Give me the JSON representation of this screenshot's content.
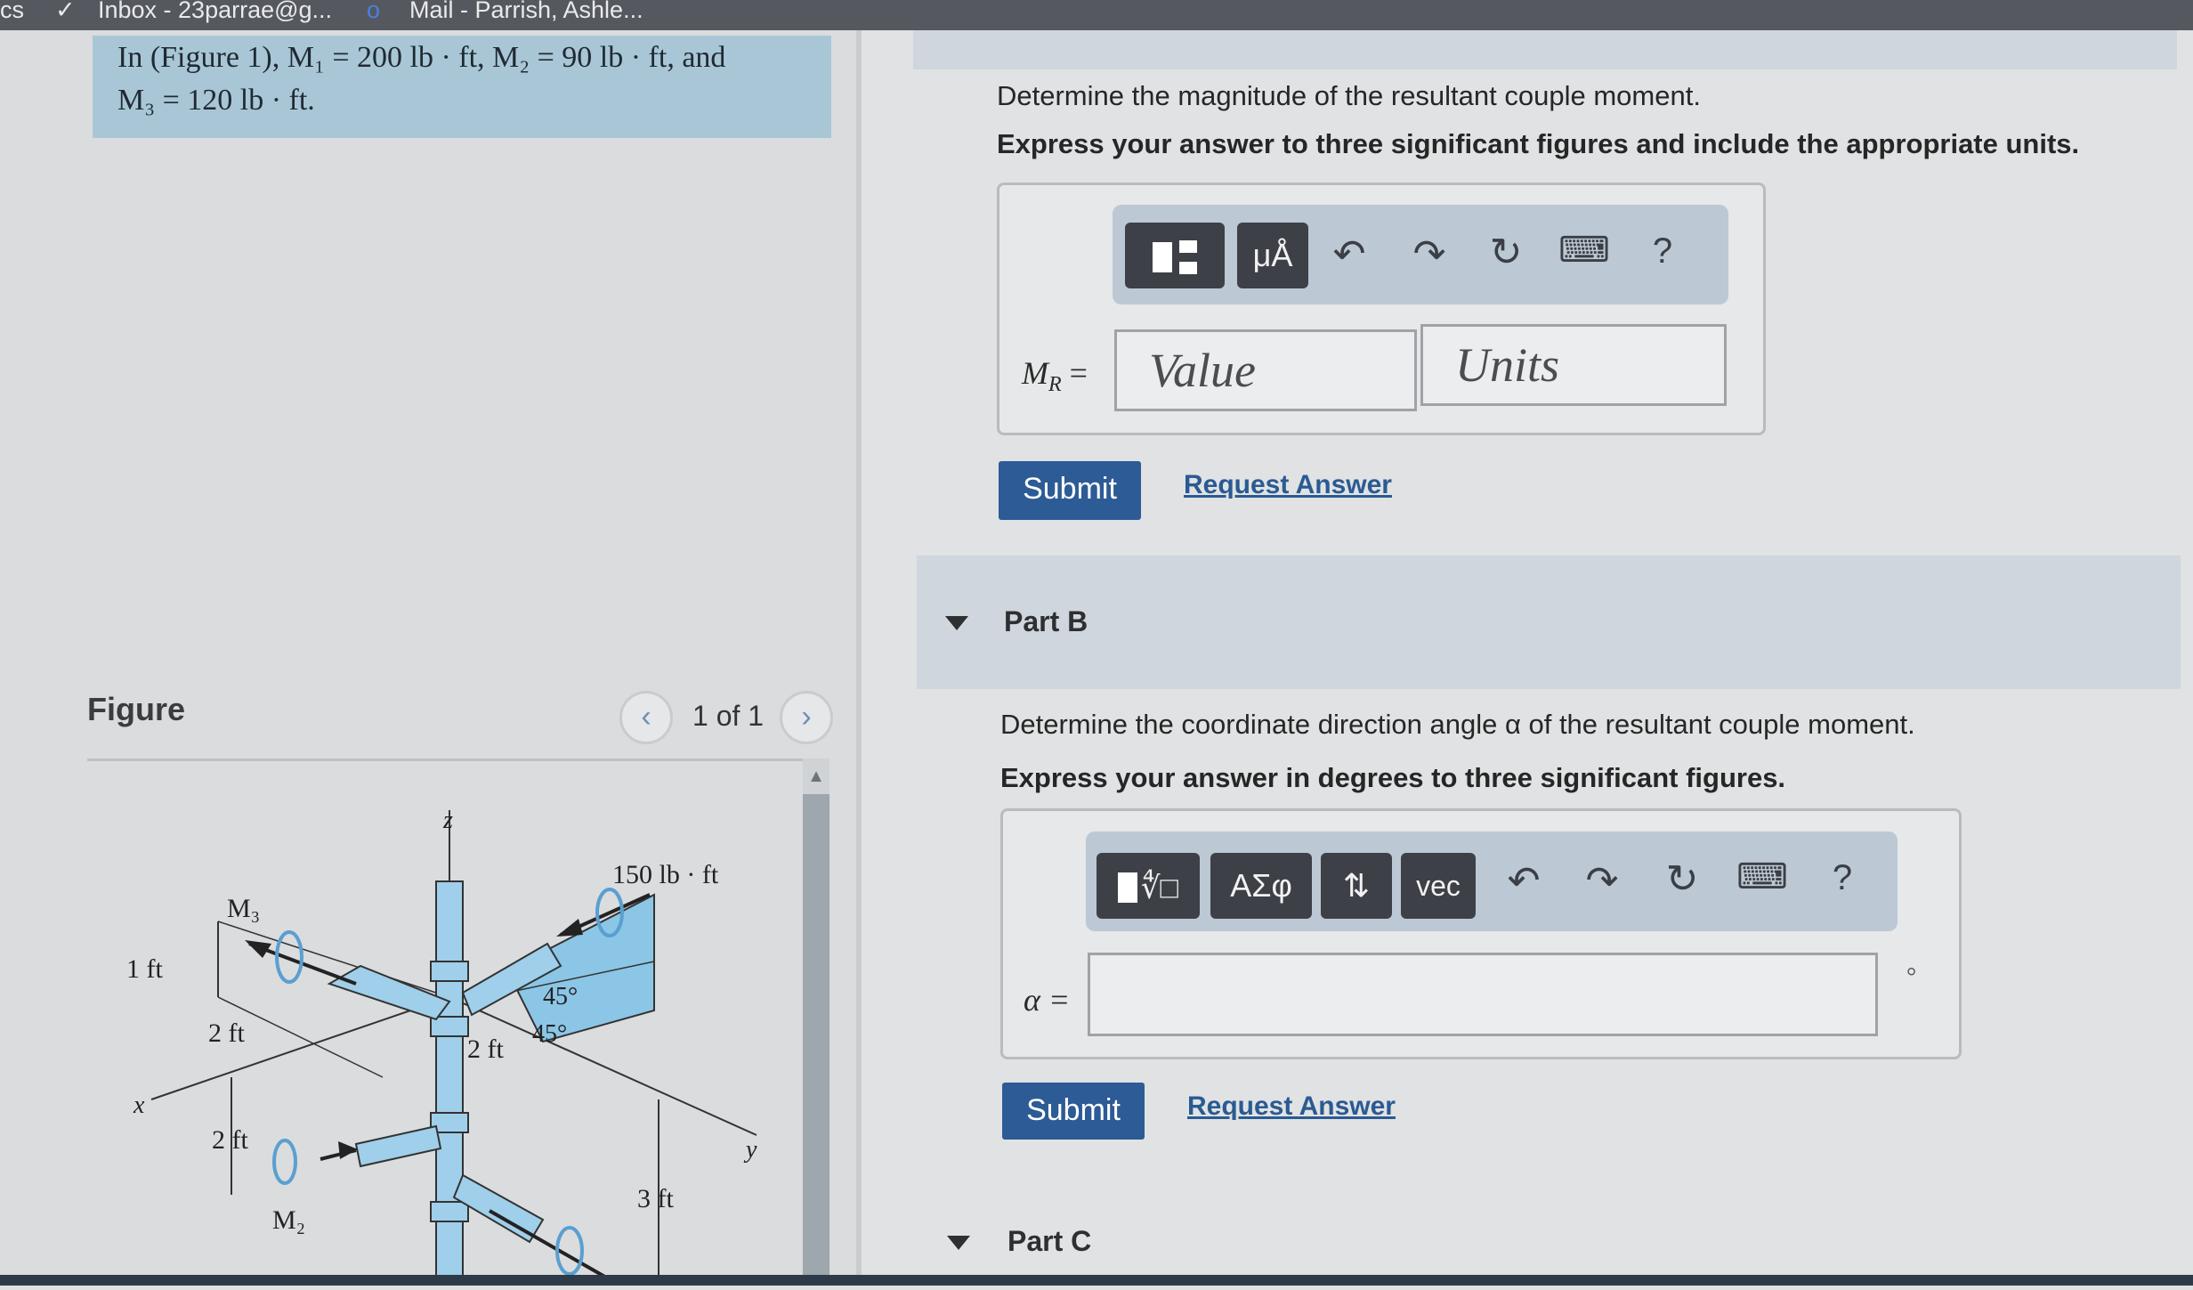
{
  "browser_tabs": [
    {
      "label": "cs"
    },
    {
      "label": "Inbox - 23parrae@g..."
    },
    {
      "label": "Mail - Parrish, Ashle..."
    }
  ],
  "problem": {
    "line1": "In (Figure 1), M₁ = 200 lb · ft, M₂ = 90 lb · ft, and",
    "line2": "M₃ = 120 lb · ft."
  },
  "figure": {
    "heading": "Figure",
    "pager": "1 of 1",
    "prev_icon": "‹",
    "next_icon": "›",
    "labels": {
      "z": "z",
      "x": "x",
      "y": "y",
      "m3": "M₃",
      "m2": "M₂",
      "moment": "150 lb · ft",
      "dim_1ft": "1 ft",
      "dim_2ft_a": "2 ft",
      "dim_2ft_b": "2 ft",
      "dim_2ft_c": "2 ft",
      "dim_3ft": "3 ft",
      "angle_a": "45°",
      "angle_b": "45°"
    }
  },
  "part_a": {
    "prompt": "Determine the magnitude of the resultant couple moment.",
    "instruction": "Express your answer to three significant figures and include the appropriate units.",
    "toolbar": [
      "templates-icon",
      "μÅ",
      "undo-icon",
      "redo-icon",
      "reset-icon",
      "keyboard-icon",
      "?"
    ],
    "label": "M",
    "label_sub": "R",
    "label_eq": " =",
    "value_placeholder": "Value",
    "units_placeholder": "Units",
    "submit": "Submit",
    "request": "Request Answer"
  },
  "part_b": {
    "heading": "Part B",
    "prompt": "Determine the coordinate direction angle α of the resultant couple moment.",
    "instruction": "Express your answer in degrees to three significant figures.",
    "toolbar": [
      "templates-icon",
      "ΑΣφ",
      "⇅",
      "vec",
      "undo-icon",
      "redo-icon",
      "reset-icon",
      "keyboard-icon",
      "?"
    ],
    "label": "α =",
    "unit": "°",
    "submit": "Submit",
    "request": "Request Answer"
  },
  "part_c": {
    "heading": "Part C"
  },
  "colors": {
    "accent": "#2c5b95",
    "toolbar_bg": "#bcc8d4",
    "problem_bg": "#a9c6d6"
  }
}
